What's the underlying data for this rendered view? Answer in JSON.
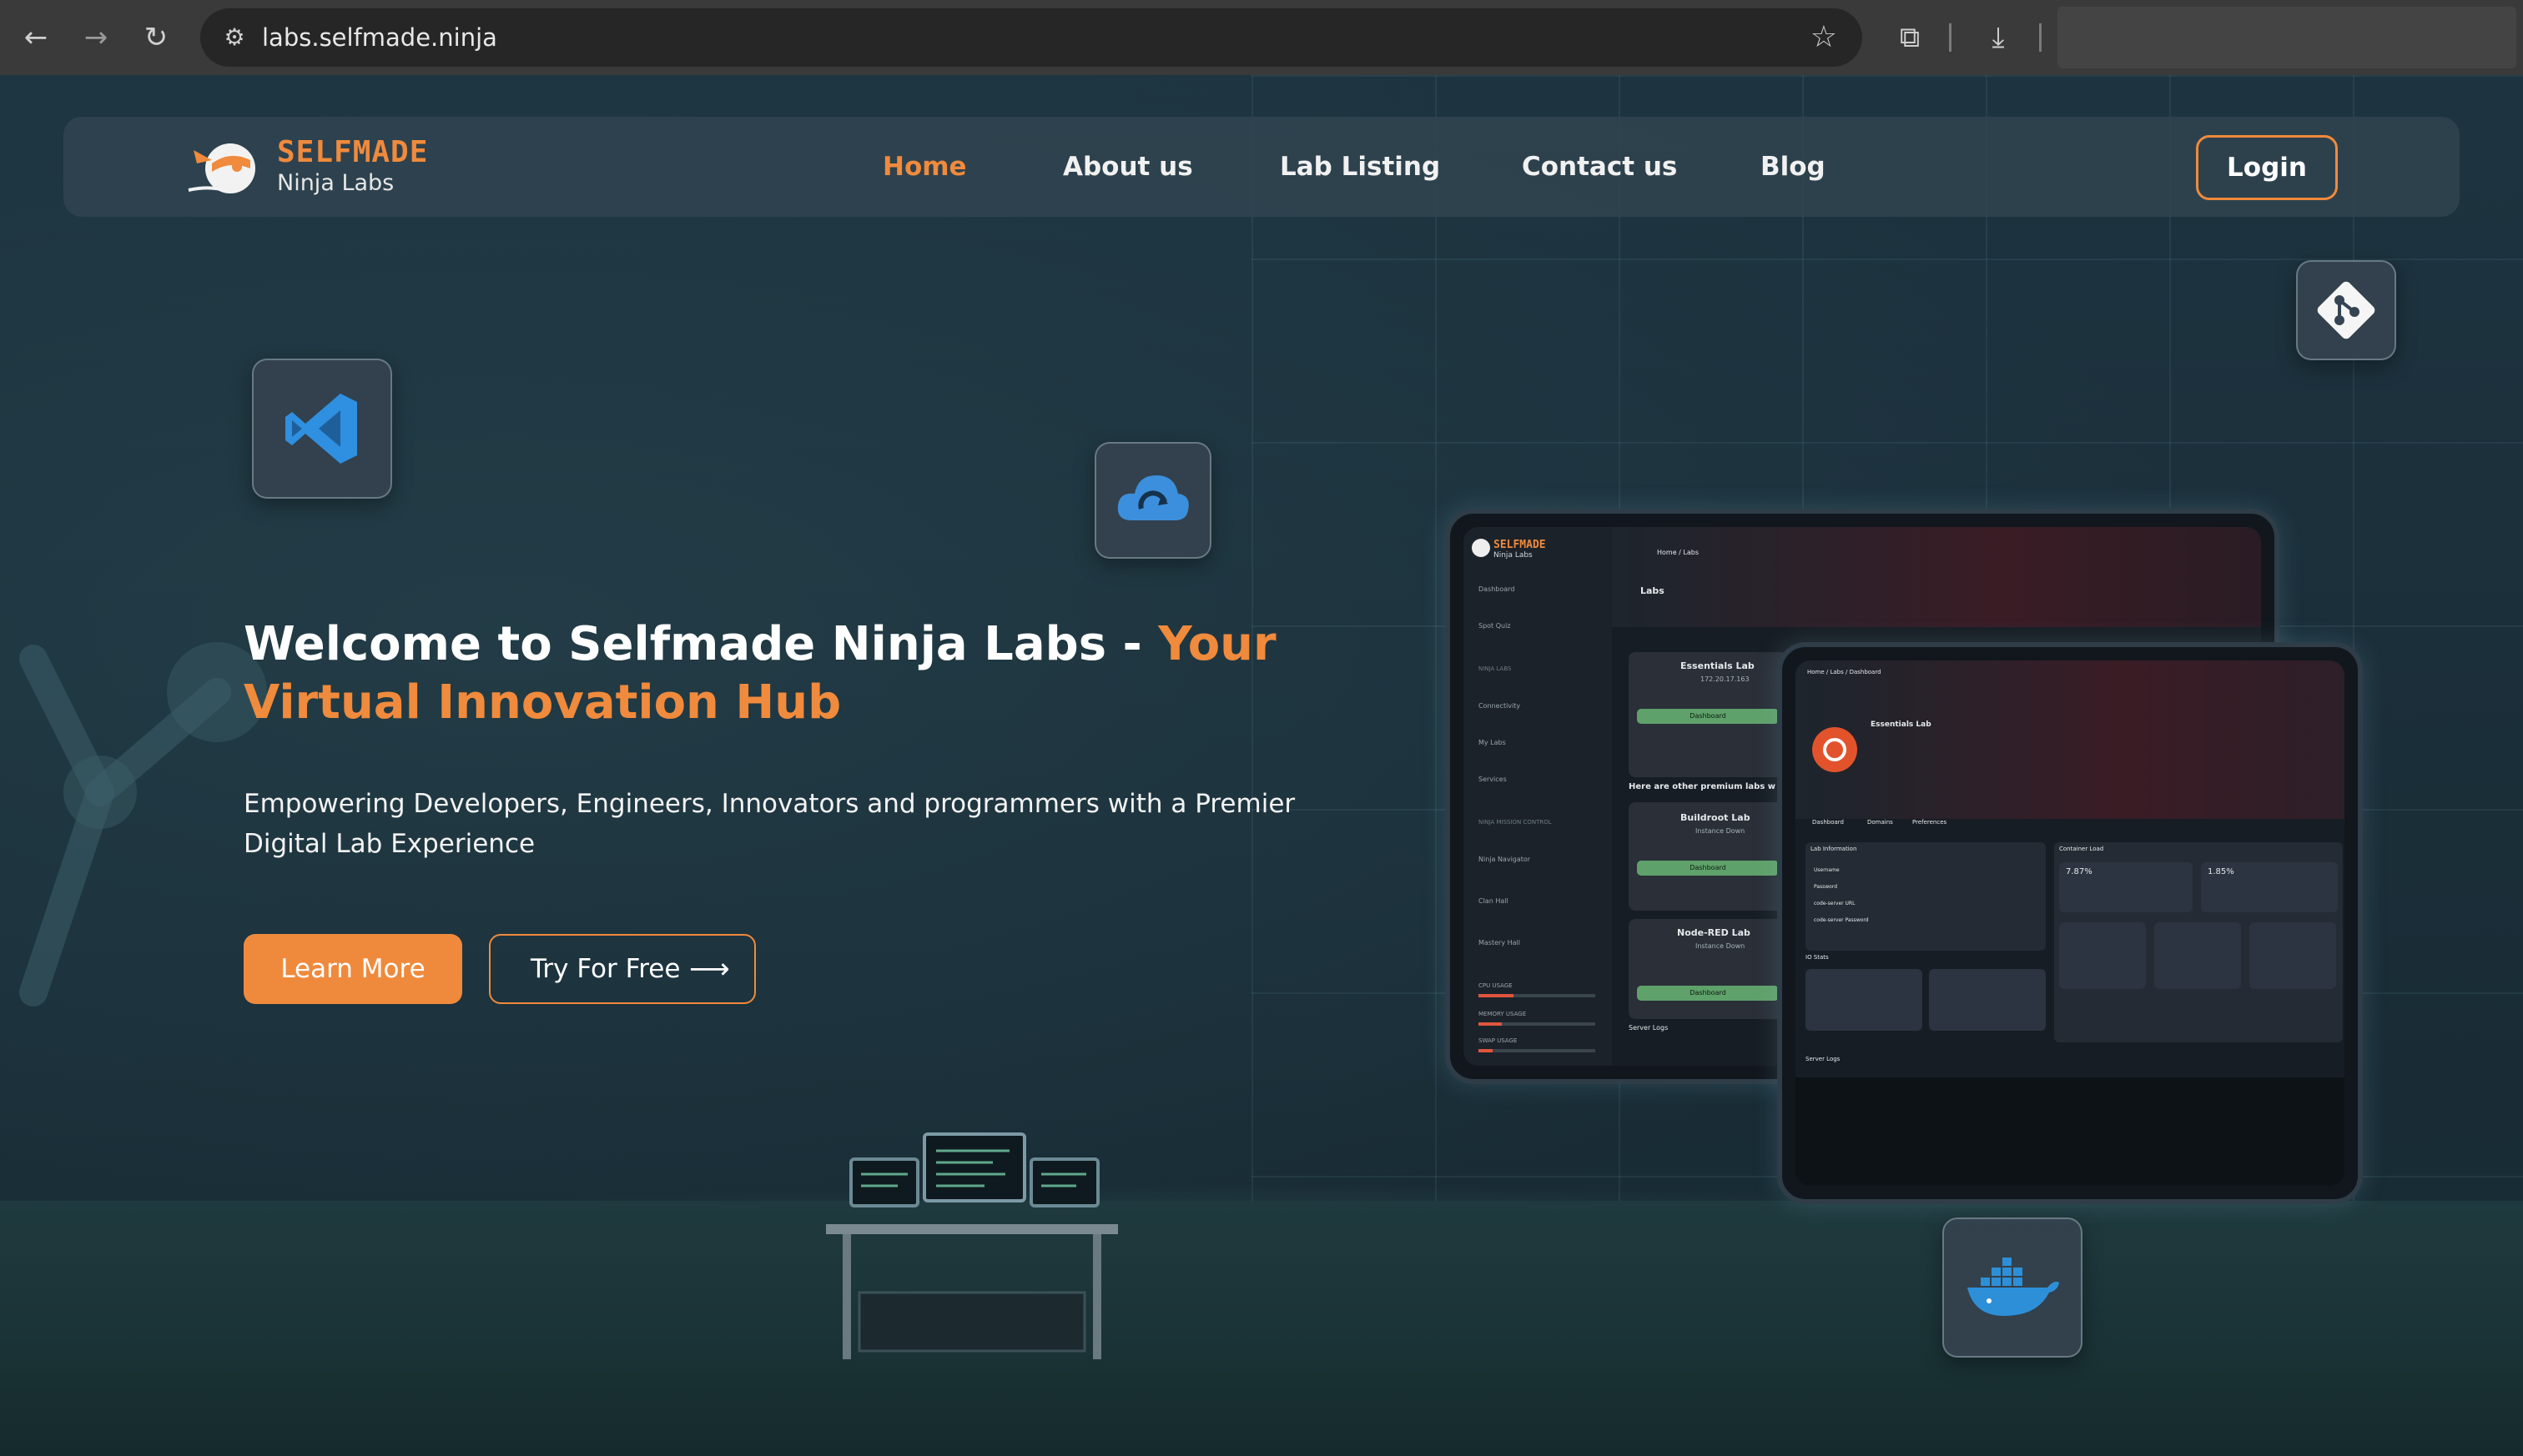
{
  "browser": {
    "url": "labs.selfmade.ninja",
    "icons": [
      "back-arrow-icon",
      "forward-arrow-icon",
      "reload-icon",
      "site-settings-icon",
      "bookmark-star-icon",
      "extensions-icon",
      "download-icon"
    ]
  },
  "navbar": {
    "brand": "SELFMADE",
    "brand_sub": "Ninja Labs",
    "links": [
      "Home",
      "About us",
      "Lab Listing",
      "Contact us",
      "Blog"
    ],
    "active_link": "Home",
    "login_label": "Login"
  },
  "hero": {
    "title_main": "Welcome to Selfmade Ninja Labs - ",
    "title_highlight": "Your Virtual Innovation Hub",
    "subtitle": "Empowering Developers, Engineers, Innovators and programmers with a Premier Digital Lab Experience",
    "learn_more_label": "Learn More",
    "try_free_label": "Try For Free",
    "try_free_arrow": "⟶"
  },
  "colors": {
    "accent": "#f08a3c",
    "background": "#1b2f3a",
    "navbar_bg": "#304450",
    "text": "#ffffff"
  },
  "floating_icons": [
    "vscode-icon",
    "cloud-sync-icon",
    "git-icon",
    "docker-icon"
  ],
  "mockup_back": {
    "brand": "SELFMADE",
    "brand_sub": "Ninja Labs",
    "breadcrumb": "Home / Labs",
    "heading": "Labs",
    "sidebar": [
      "Dashboard",
      "Spot Quiz",
      "NINJA LABS",
      "Connectivity",
      "My Labs",
      "Services",
      "NINJA MISSION CONTROL",
      "Ninja Navigator",
      "Clan Hall",
      "Mastery Hall"
    ],
    "cards": [
      {
        "title": "Essentials Lab",
        "sub": "172.20.17.163",
        "button": "Dashboard"
      },
      {
        "title": "Buildroot Lab",
        "sub": "Instance Down",
        "button": "Dashboard"
      },
      {
        "title": "Node-RED Lab",
        "sub": "Instance Down",
        "button": "Dashboard"
      }
    ],
    "premium_text": "Here are other premium labs w",
    "cpu_label": "CPU USAGE",
    "memory_label": "MEMORY USAGE",
    "swap_label": "SWAP USAGE",
    "server_logs": "Server Logs"
  },
  "mockup_front": {
    "breadcrumb": "Home / Labs / Dashboard",
    "title": "Essentials Lab",
    "tabs": [
      "Dashboard",
      "Domains",
      "Preferences"
    ],
    "section_info": "Lab Information",
    "section_load": "Container Load",
    "fields": [
      "Username",
      "Password",
      "code-server URL",
      "code-server Password"
    ],
    "cpu_value": "7.87%",
    "mem_value": "1.85%",
    "io_label": "IO Stats",
    "server_logs": "Server Logs"
  }
}
